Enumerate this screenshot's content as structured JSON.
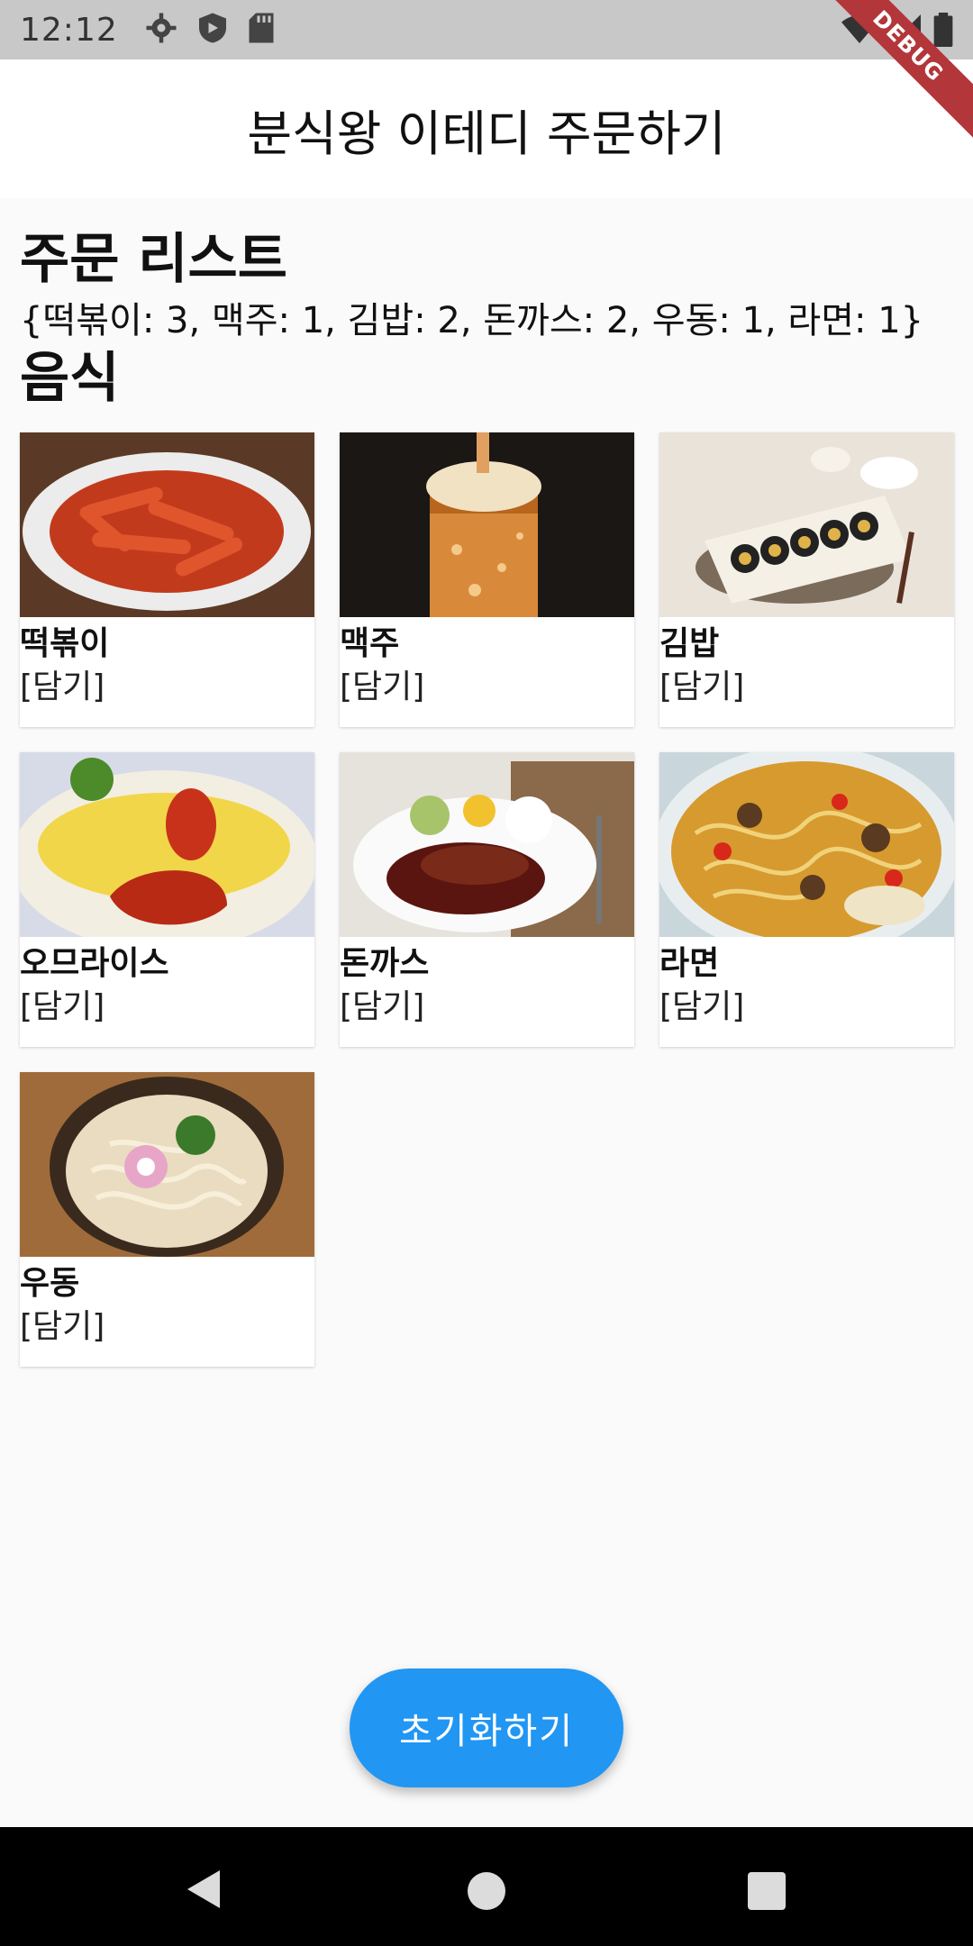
{
  "status_bar": {
    "time": "12:12"
  },
  "debug_label": "DEBUG",
  "app_bar": {
    "title": "분식왕 이테디 주문하기"
  },
  "order_section": {
    "title": "주문 리스트",
    "summary": "{떡볶이: 3, 맥주: 1, 김밥: 2, 돈까스: 2, 우동: 1, 라면: 1}"
  },
  "food_section": {
    "title": "음식"
  },
  "foods": [
    {
      "name": "떡볶이",
      "action": "[담기]"
    },
    {
      "name": "맥주",
      "action": "[담기]"
    },
    {
      "name": "김밥",
      "action": "[담기]"
    },
    {
      "name": "오므라이스",
      "action": "[담기]"
    },
    {
      "name": "돈까스",
      "action": "[담기]"
    },
    {
      "name": "라면",
      "action": "[담기]"
    },
    {
      "name": "우동",
      "action": "[담기]"
    }
  ],
  "reset_button": {
    "label": "초기화하기"
  },
  "colors": {
    "accent": "#2196f3",
    "debug_ribbon": "#b3363a",
    "status_bar": "#c8c8c8"
  }
}
